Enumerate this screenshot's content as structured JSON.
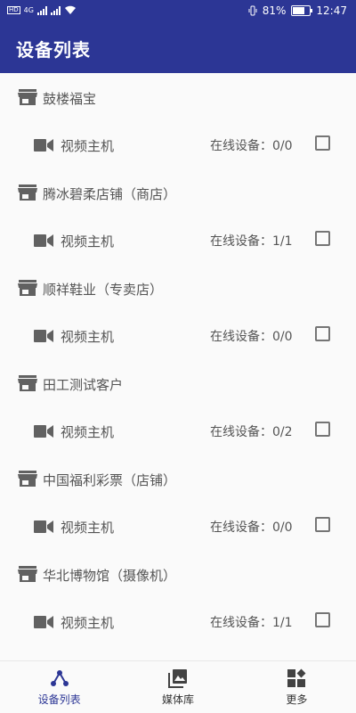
{
  "statusbar": {
    "network_badge": "HD",
    "network_type": "4G",
    "battery_percent": "81%",
    "battery_level": 0.81,
    "time": "12:47"
  },
  "appbar": {
    "title": "设备列表"
  },
  "groups": [
    {
      "name": "鼓楼福宝",
      "device": {
        "label": "视频主机",
        "status": "在线设备：0/0",
        "checked": false
      }
    },
    {
      "name": "腾冰碧柔店铺（商店）",
      "device": {
        "label": "视频主机",
        "status": "在线设备：1/1",
        "checked": false
      }
    },
    {
      "name": "顺祥鞋业（专卖店）",
      "device": {
        "label": "视频主机",
        "status": "在线设备：0/0",
        "checked": false
      }
    },
    {
      "name": "田工测试客户",
      "device": {
        "label": "视频主机",
        "status": "在线设备：0/2",
        "checked": false
      }
    },
    {
      "name": "中国福利彩票（店铺）",
      "device": {
        "label": "视频主机",
        "status": "在线设备：0/0",
        "checked": false
      }
    },
    {
      "name": "华北博物馆（摄像机）",
      "device": {
        "label": "视频主机",
        "status": "在线设备：1/1",
        "checked": false
      }
    }
  ],
  "bottom_nav": [
    {
      "label": "设备列表",
      "icon": "device-tree-icon",
      "active": true
    },
    {
      "label": "媒体库",
      "icon": "media-library-icon",
      "active": false
    },
    {
      "label": "更多",
      "icon": "more-apps-icon",
      "active": false
    }
  ],
  "colors": {
    "primary": "#2c3695",
    "icon_gray": "#616161"
  }
}
